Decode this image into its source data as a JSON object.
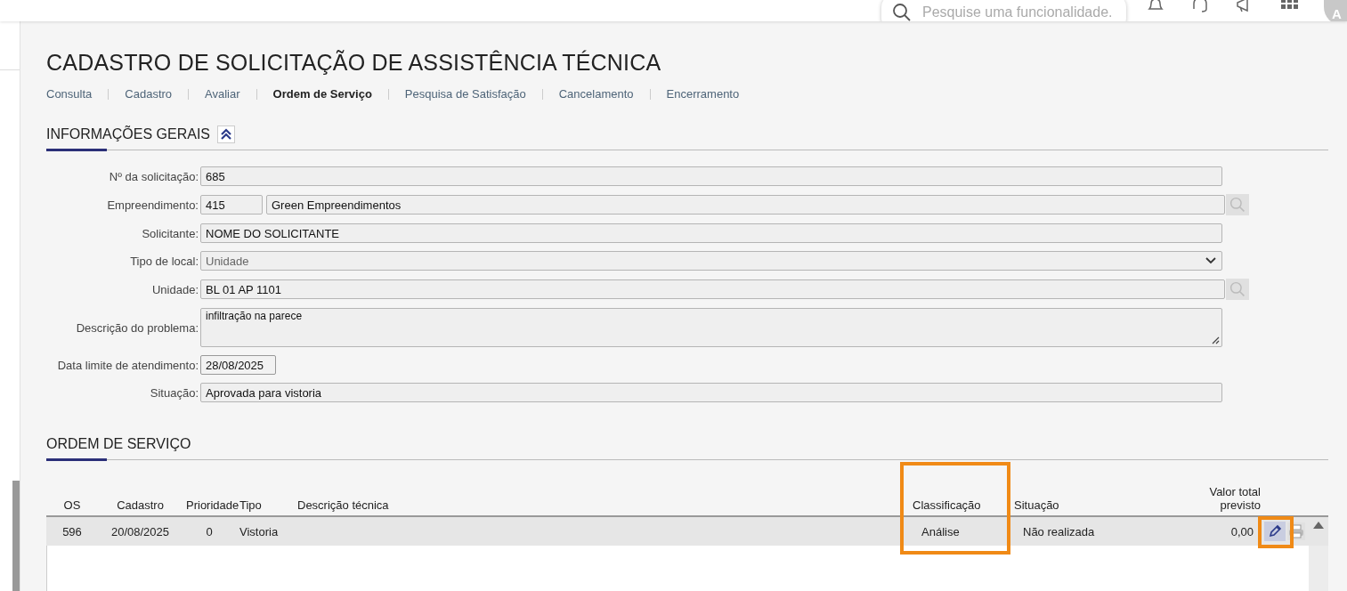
{
  "header": {
    "search": {
      "placeholder": "Pesquise uma funcionalidade."
    },
    "avatar": "A"
  },
  "title": "CADASTRO DE SOLICITAÇÃO DE ASSISTÊNCIA TÉCNICA",
  "tabs": [
    {
      "label": "Consulta",
      "selected": false
    },
    {
      "label": "Cadastro",
      "selected": false
    },
    {
      "label": "Avaliar",
      "selected": false
    },
    {
      "label": "Ordem de Serviço",
      "selected": true
    },
    {
      "label": "Pesquisa de Satisfação",
      "selected": false
    },
    {
      "label": "Cancelamento",
      "selected": false
    },
    {
      "label": "Encerramento",
      "selected": false
    }
  ],
  "general": {
    "title": "INFORMAÇÕES GERAIS",
    "expanded": true,
    "fields": [
      {
        "kind": "text",
        "label": "Nº da solicitação:",
        "value": "685"
      },
      {
        "kind": "lookup",
        "label": "Empreendimento:",
        "code": "415",
        "value": "Green Empreendimentos"
      },
      {
        "kind": "text",
        "label": "Solicitante:",
        "value": "NOME DO SOLICITANTE"
      },
      {
        "kind": "select",
        "label": "Tipo de local:",
        "value": "Unidade"
      },
      {
        "kind": "lookup",
        "label": "Unidade:",
        "value": "BL 01 AP 1101"
      },
      {
        "kind": "textarea",
        "label": "Descrição do problema:",
        "value": "infiltração na parece"
      },
      {
        "kind": "date",
        "label": "Data limite de atendimento:",
        "value": "28/08/2025"
      },
      {
        "kind": "text",
        "label": "Situação:",
        "value": "Aprovada para vistoria"
      }
    ]
  },
  "orders": {
    "title": "ORDEM DE SERVIÇO",
    "columns": [
      {
        "label": "OS",
        "highlighted": false
      },
      {
        "label": "Cadastro",
        "highlighted": false
      },
      {
        "label": "Prioridade",
        "highlighted": false
      },
      {
        "label": "Tipo",
        "highlighted": false
      },
      {
        "label": "Descrição técnica",
        "highlighted": false
      },
      {
        "label": "Classificação",
        "highlighted": true
      },
      {
        "label": "Situação",
        "highlighted": false
      },
      {
        "label": "Valor total previsto",
        "highlighted": false
      }
    ],
    "rows": [
      {
        "cells": [
          "596",
          "20/08/2025",
          "0",
          "Vistoria",
          "",
          "Análise",
          "Não realizada",
          "0,00"
        ],
        "edit_highlighted": true
      }
    ]
  }
}
